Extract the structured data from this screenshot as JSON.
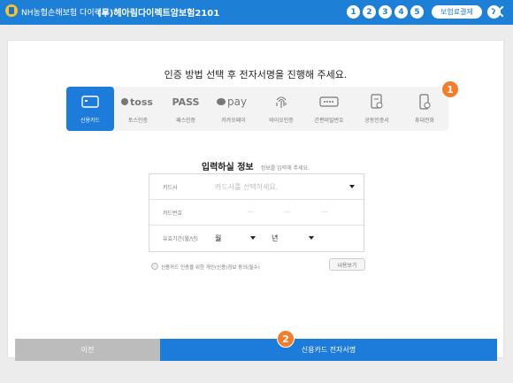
{
  "header": {
    "company": "NH농협손해보험 다이렉트",
    "product": "(무)헤아림다이렉트암보험2101",
    "steps": [
      "1",
      "2",
      "3",
      "4",
      "5"
    ],
    "pay_label": "보험료결제",
    "last_step": "7"
  },
  "main": {
    "title": "인증 방법 선택 후 전자서명을 진행해 주세요.",
    "methods": [
      {
        "label": "신용카드",
        "icon": "credit-card-icon",
        "active": true
      },
      {
        "label": "토스인증",
        "icon": "toss-logo",
        "logo_text": "toss"
      },
      {
        "label": "패스인증",
        "icon": "pass-logo",
        "logo_text": "PASS"
      },
      {
        "label": "카카오페이",
        "icon": "kakaopay-logo",
        "logo_text": "pay"
      },
      {
        "label": "바이오인증",
        "icon": "fingerprint-icon"
      },
      {
        "label": "간편비밀번호",
        "icon": "pin-password-icon"
      },
      {
        "label": "공동인증서",
        "icon": "certificate-icon"
      },
      {
        "label": "휴대전화",
        "icon": "mobile-phone-icon"
      }
    ],
    "badges": [
      "1",
      "2"
    ],
    "form_title": "입력하실 정보",
    "form_subtitle": "정보를 입력해 주세요.",
    "form": {
      "card_company_label": "카드사",
      "card_company_placeholder": "카드사를 선택하세요.",
      "card_number_label": "카드번호",
      "expiry_label": "유효기간(월/년)",
      "month_label": "월",
      "year_label": "년"
    },
    "consent_text": "신용카드 인증을 위한 개인(신용)정보 동의(필수)",
    "view_button": "내용보기"
  },
  "footer": {
    "prev_label": "이전",
    "next_label": "신용카드 전자서명"
  },
  "colors": {
    "primary": "#1d7bd9",
    "badge": "#f27d2a",
    "disabled": "#bcbcbc"
  }
}
